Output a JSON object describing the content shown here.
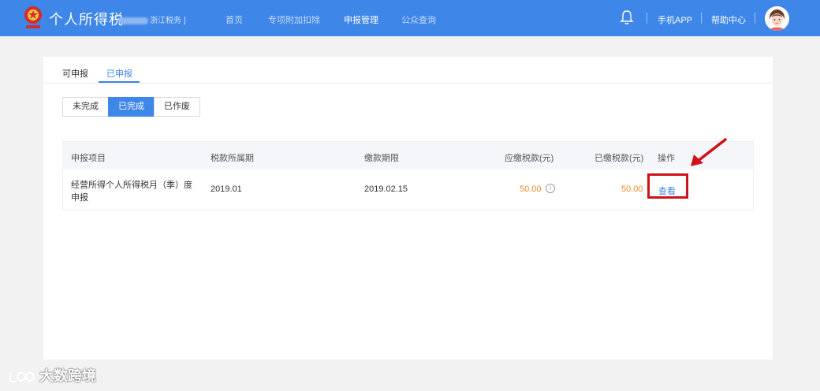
{
  "header": {
    "brand": "个人所得税",
    "region": "浙江税务 ]",
    "nav": [
      "首页",
      "专项附加扣除",
      "申报管理",
      "公众查询"
    ],
    "active_nav": "申报管理",
    "app_link": "手机APP",
    "help_link": "帮助中心",
    "bell_icon": "bell-icon",
    "colors": {
      "bar": "#3e86e8"
    }
  },
  "tabs": [
    "可申报",
    "已申报"
  ],
  "active_tab": "已申报",
  "status_filters": [
    "未完成",
    "已完成",
    "已作废"
  ],
  "active_filter": "已完成",
  "table": {
    "columns": [
      "申报项目",
      "税款所属期",
      "缴款期限",
      "应缴税款(元)",
      "已缴税款(元)",
      "操作"
    ],
    "rows": [
      {
        "item_line1": "经营所得个人所得税月（季）度",
        "item_line2": "申报",
        "period": "2019.01",
        "deadline": "2019.02.15",
        "tax_due": "50.00",
        "tax_paid": "50.00",
        "action": "查看"
      }
    ]
  },
  "annotation": {
    "highlight_color": "#d0111b"
  },
  "watermark": "大数跨境"
}
